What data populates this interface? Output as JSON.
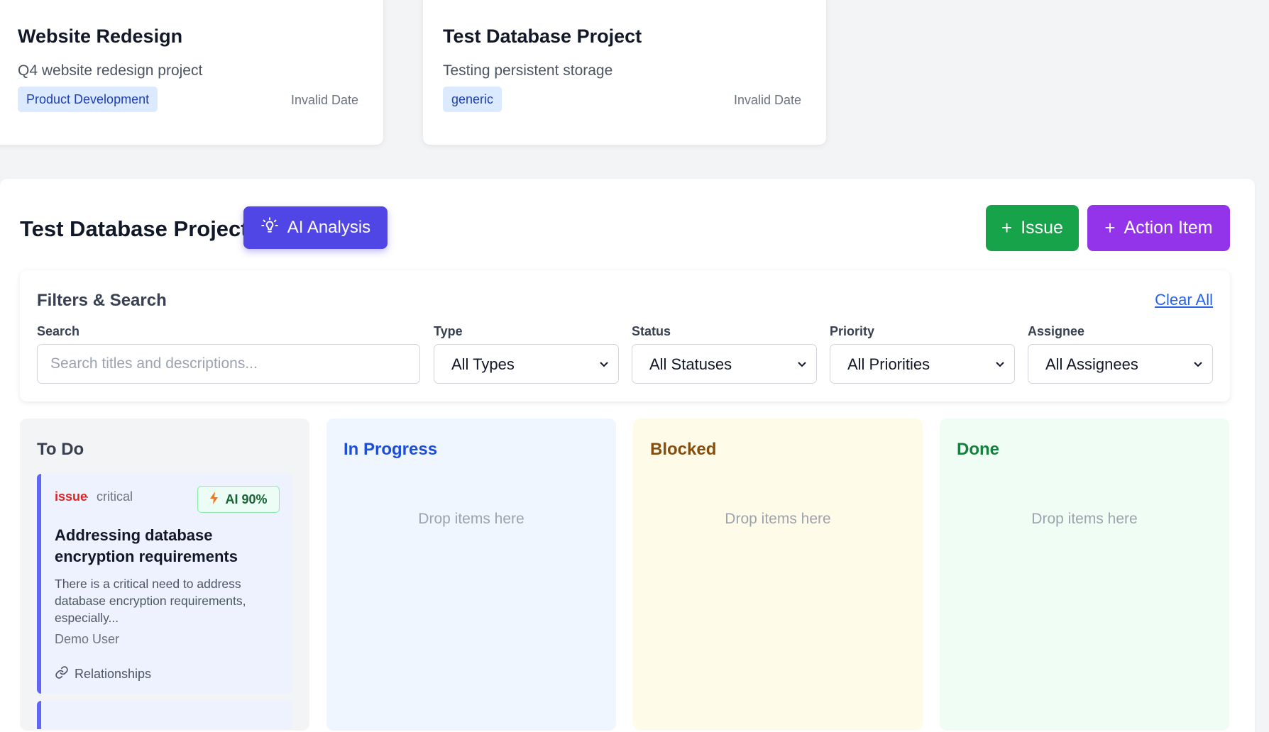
{
  "projects": [
    {
      "title": "Website Redesign",
      "description": "Q4 website redesign project",
      "tag": "Product Development",
      "date": "Invalid Date"
    },
    {
      "title": "Test Database Project",
      "description": "Testing persistent storage",
      "tag": "generic",
      "date": "Invalid Date"
    }
  ],
  "header": {
    "title": "Test Database Project",
    "ai_button": "AI Analysis",
    "issue_button": "Issue",
    "action_button": "Action Item",
    "plus": "+"
  },
  "filters": {
    "title": "Filters & Search",
    "clear_all": "Clear All",
    "search_label": "Search",
    "search_placeholder": "Search titles and descriptions...",
    "type_label": "Type",
    "type_value": "All Types",
    "status_label": "Status",
    "status_value": "All Statuses",
    "priority_label": "Priority",
    "priority_value": "All Priorities",
    "assignee_label": "Assignee",
    "assignee_value": "All Assignees"
  },
  "columns": [
    {
      "title": "To Do",
      "color": "#374151",
      "bg": "#f3f4f6"
    },
    {
      "title": "In Progress",
      "color": "#1d4ed8",
      "bg": "#eff6ff",
      "empty": "Drop items here"
    },
    {
      "title": "Blocked",
      "color": "#854d0e",
      "bg": "#fefce8",
      "empty": "Drop items here"
    },
    {
      "title": "Done",
      "color": "#15803d",
      "bg": "#f0fdf4",
      "empty": "Drop items here"
    }
  ],
  "item": {
    "type": "issue",
    "separator": "·",
    "priority": "critical",
    "ai_badge": "AI 90%",
    "title": "Addressing database encryption requirements",
    "description": "There is a critical need to address database encryption requirements, especially...",
    "assignee": "Demo User",
    "relationships": "Relationships"
  },
  "icons": {
    "ai_button": "lightbulb-icon",
    "ai_badge": "lightning-icon",
    "relationships": "link-icon",
    "select": "chevron-down-icon"
  }
}
